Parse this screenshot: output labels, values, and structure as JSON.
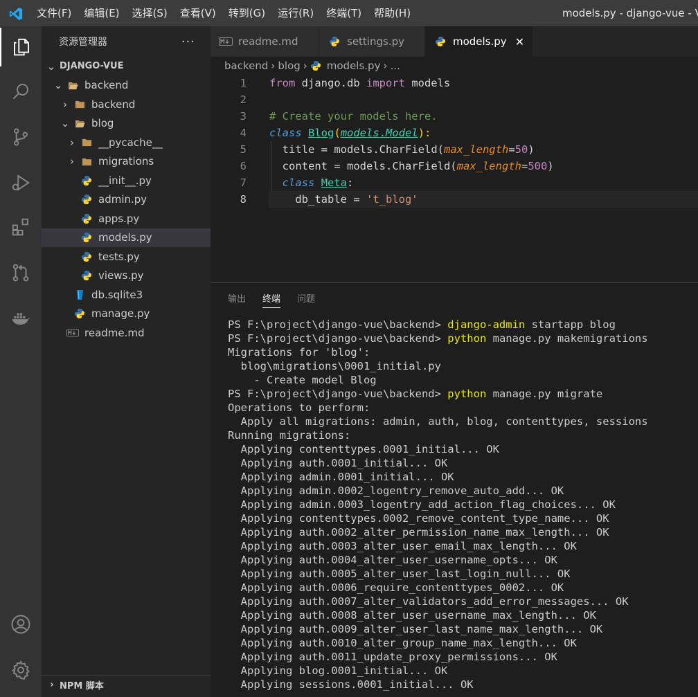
{
  "titlebar": {
    "menu": [
      "文件(F)",
      "编辑(E)",
      "选择(S)",
      "查看(V)",
      "转到(G)",
      "运行(R)",
      "终端(T)",
      "帮助(H)"
    ],
    "window_title": "models.py - django-vue - Vis"
  },
  "activity_bar": {
    "items": [
      "explorer-icon",
      "search-icon",
      "source-control-icon",
      "run-debug-icon",
      "extensions-icon",
      "pull-request-icon",
      "docker-icon"
    ],
    "bottom": [
      "account-icon",
      "settings-gear-icon"
    ]
  },
  "sidebar": {
    "title": "资源管理器",
    "more": "···",
    "root": "DJANGO-VUE",
    "tree": [
      {
        "label": "backend",
        "type": "folder",
        "depth": 1,
        "expanded": true
      },
      {
        "label": "backend",
        "type": "folder",
        "depth": 2,
        "expanded": false
      },
      {
        "label": "blog",
        "type": "folder",
        "depth": 2,
        "expanded": true
      },
      {
        "label": "__pycache__",
        "type": "folder",
        "depth": 3,
        "expanded": false
      },
      {
        "label": "migrations",
        "type": "folder",
        "depth": 3,
        "expanded": false
      },
      {
        "label": "__init__.py",
        "type": "python",
        "depth": 3
      },
      {
        "label": "admin.py",
        "type": "python",
        "depth": 3
      },
      {
        "label": "apps.py",
        "type": "python",
        "depth": 3
      },
      {
        "label": "models.py",
        "type": "python",
        "depth": 3,
        "selected": true
      },
      {
        "label": "tests.py",
        "type": "python",
        "depth": 3
      },
      {
        "label": "views.py",
        "type": "python",
        "depth": 3
      },
      {
        "label": "db.sqlite3",
        "type": "database",
        "depth": 2
      },
      {
        "label": "manage.py",
        "type": "python",
        "depth": 2
      },
      {
        "label": "readme.md",
        "type": "markdown",
        "depth": 1
      }
    ],
    "footer": "NPM 脚本"
  },
  "tabs": [
    {
      "label": "readme.md",
      "icon": "markdown-icon",
      "active": false
    },
    {
      "label": "settings.py",
      "icon": "python-icon",
      "active": false
    },
    {
      "label": "models.py",
      "icon": "python-icon",
      "active": true,
      "close": "✕"
    }
  ],
  "breadcrumb": {
    "parts": [
      "backend",
      "blog",
      "models.py",
      "..."
    ],
    "separator": "›"
  },
  "editor": {
    "line_numbers": [
      "1",
      "2",
      "3",
      "4",
      "5",
      "6",
      "7",
      "8"
    ],
    "current_line": 8
  },
  "panel": {
    "tabs": [
      "输出",
      "终端",
      "问题"
    ],
    "active_tab": "终端"
  },
  "terminal": {
    "lines": [
      {
        "prompt": "PS F:\\project\\django-vue\\backend> ",
        "cmd": "django-admin",
        "rest": " startapp blog"
      },
      {
        "prompt": "PS F:\\project\\django-vue\\backend> ",
        "cmd": "python",
        "rest": " manage.py makemigrations"
      },
      {
        "text": "Migrations for 'blog':"
      },
      {
        "text": "  blog\\migrations\\0001_initial.py"
      },
      {
        "text": "    - Create model Blog"
      },
      {
        "prompt": "PS F:\\project\\django-vue\\backend> ",
        "cmd": "python",
        "rest": " manage.py migrate"
      },
      {
        "text": "Operations to perform:"
      },
      {
        "text": "  Apply all migrations: admin, auth, blog, contenttypes, sessions"
      },
      {
        "text": "Running migrations:"
      },
      {
        "text": "  Applying contenttypes.0001_initial... OK"
      },
      {
        "text": "  Applying auth.0001_initial... OK"
      },
      {
        "text": "  Applying admin.0001_initial... OK"
      },
      {
        "text": "  Applying admin.0002_logentry_remove_auto_add... OK"
      },
      {
        "text": "  Applying admin.0003_logentry_add_action_flag_choices... OK"
      },
      {
        "text": "  Applying contenttypes.0002_remove_content_type_name... OK"
      },
      {
        "text": "  Applying auth.0002_alter_permission_name_max_length... OK"
      },
      {
        "text": "  Applying auth.0003_alter_user_email_max_length... OK"
      },
      {
        "text": "  Applying auth.0004_alter_user_username_opts... OK"
      },
      {
        "text": "  Applying auth.0005_alter_user_last_login_null... OK"
      },
      {
        "text": "  Applying auth.0006_require_contenttypes_0002... OK"
      },
      {
        "text": "  Applying auth.0007_alter_validators_add_error_messages... OK"
      },
      {
        "text": "  Applying auth.0008_alter_user_username_max_length... OK"
      },
      {
        "text": "  Applying auth.0009_alter_user_last_name_max_length... OK"
      },
      {
        "text": "  Applying auth.0010_alter_group_name_max_length... OK"
      },
      {
        "text": "  Applying auth.0011_update_proxy_permissions... OK"
      },
      {
        "text": "  Applying blog.0001_initial... OK"
      },
      {
        "text": "  Applying sessions.0001_initial... OK"
      }
    ]
  },
  "code": {
    "l1": {
      "kw": "from",
      "mod": " django.db ",
      "kw2": "import",
      "rest": " models"
    },
    "l3": {
      "comment": "# Create your models here."
    },
    "l4": {
      "kw": "class",
      "sp": " ",
      "name": "Blog",
      "open": "(",
      "module": "models",
      "dot": ".",
      "base": "Model",
      "close": "):"
    },
    "l5": {
      "ind": "  ",
      "field": "title",
      "eq": " = ",
      "call": "models.CharField(",
      "arg": "max_length",
      "aeq": "=",
      "num": "50",
      "end": ")"
    },
    "l6": {
      "ind": "  ",
      "field": "content",
      "eq": " = ",
      "call": "models.CharField(",
      "arg": "max_length",
      "aeq": "=",
      "num": "500",
      "end": ")"
    },
    "l7": {
      "ind": "  ",
      "kw": "class",
      "sp": " ",
      "name": "Meta",
      "colon": ":"
    },
    "l8": {
      "ind": "    ",
      "field": "db_table",
      "eq": " = ",
      "str": "'t_blog'"
    }
  },
  "colors": {
    "titlebar": "#3c3c3c",
    "activitybar": "#333333",
    "sidebar": "#252526",
    "editor": "#1e1e1e",
    "keyword": "#c586c0",
    "class": "#4ec9b0",
    "comment": "#6a9955",
    "string": "#ce9178",
    "terminal_cmd": "#e5e510",
    "python_blue": "#3572a5",
    "python_yellow": "#ffd43b",
    "folder": "#c09553"
  }
}
